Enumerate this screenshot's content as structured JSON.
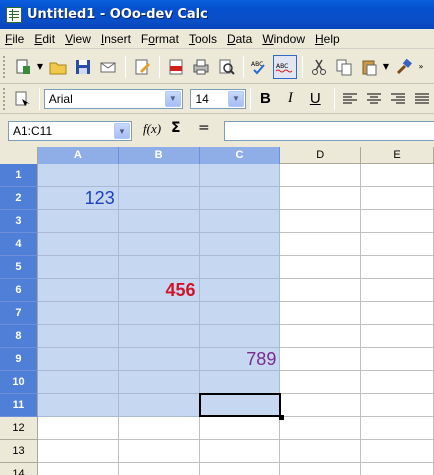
{
  "window": {
    "title": "Untitled1 - OOo-dev Calc"
  },
  "menu": [
    {
      "key": "file",
      "label": "File",
      "accel": "F",
      "rest": "ile"
    },
    {
      "key": "edit",
      "label": "Edit",
      "accel": "E",
      "rest": "dit"
    },
    {
      "key": "view",
      "label": "View",
      "accel": "V",
      "rest": "iew"
    },
    {
      "key": "insert",
      "label": "Insert",
      "accel": "I",
      "rest": "nsert"
    },
    {
      "key": "format",
      "label": "Format",
      "accel": "o",
      "pre": "F",
      "rest": "rmat"
    },
    {
      "key": "tools",
      "label": "Tools",
      "accel": "T",
      "rest": "ools"
    },
    {
      "key": "data",
      "label": "Data",
      "accel": "D",
      "rest": "ata"
    },
    {
      "key": "window",
      "label": "Window",
      "accel": "W",
      "rest": "indow"
    },
    {
      "key": "help",
      "label": "Help",
      "accel": "H",
      "rest": "elp"
    }
  ],
  "formatting": {
    "font_name": "Arial",
    "font_size": "14",
    "bold_label": "B",
    "italic_label": "I",
    "underline_label": "U"
  },
  "formula_bar": {
    "name_box": "A1:C11",
    "function_wizard_label": "f(x)",
    "sum_label": "Σ",
    "equals_label": "=",
    "input_value": ""
  },
  "sheet": {
    "columns": [
      "A",
      "B",
      "C",
      "D",
      "E"
    ],
    "selected_columns": [
      "A",
      "B",
      "C"
    ],
    "rows": [
      "1",
      "2",
      "3",
      "4",
      "5",
      "6",
      "7",
      "8",
      "9",
      "10",
      "11",
      "12",
      "13",
      "14"
    ],
    "selected_rows": 11,
    "cells": {
      "A2": {
        "value": "123",
        "color": "#1f3fc2"
      },
      "B6": {
        "value": "456",
        "color": "#d0142a",
        "bold": true
      },
      "C9": {
        "value": "789",
        "color": "#7a2a8c"
      }
    },
    "active_cell": "C11"
  },
  "colors": {
    "title_bar": "#0550cf",
    "selection_fill": "#c6d7f1",
    "selected_header": "#4f7fd6"
  }
}
